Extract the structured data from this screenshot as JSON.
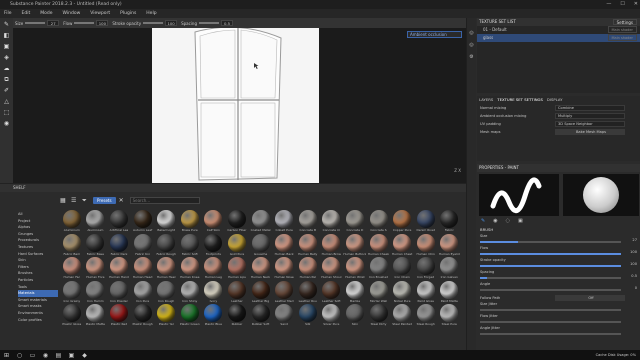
{
  "titlebar": {
    "title": "Substance Painter 2018.2.3 - Untitled (Read only)",
    "min": "—",
    "max": "☐",
    "close": "✕"
  },
  "menu": [
    "File",
    "Edit",
    "Mode",
    "Window",
    "Viewport",
    "Plugins",
    "Help"
  ],
  "toolbar": {
    "size_label": "Size",
    "size_value": "27",
    "flow_label": "Flow",
    "flow_value": "100",
    "stroke_label": "Stroke opacity",
    "stroke_value": "100",
    "spacing_label": "Spacing",
    "spacing_value": "0.5"
  },
  "viewport": {
    "dropdown": "Ambient occlusion",
    "axis": "Z X"
  },
  "shelf": {
    "title": "SHELF",
    "chip": "Presets",
    "search_placeholder": "Search...",
    "categories": [
      "All",
      "Project",
      "Alphas",
      "Grunges",
      "Procedurals",
      "Textures",
      "Hard Surfaces",
      "Skin",
      "Filters",
      "Brushes",
      "Particles",
      "Tools",
      "Materials",
      "Smart materials",
      "Smart masks",
      "Environments",
      "Color profiles"
    ],
    "selected_category": "Materials",
    "materials": [
      {
        "name": "Aluminium",
        "color": "#8a6a3a"
      },
      {
        "name": "Aluminium",
        "color": "#b8b8b8"
      },
      {
        "name": "Artificial Lea",
        "color": "#3a3a3a"
      },
      {
        "name": "Autumn Leaf",
        "color": "#3a2a1a"
      },
      {
        "name": "Baked Light",
        "color": "#e8e8e8"
      },
      {
        "name": "Brass Pure",
        "color": "#c9a24a"
      },
      {
        "name": "Calf Skin",
        "color": "#d8977a"
      },
      {
        "name": "Carbon Fiber",
        "color": "#222222"
      },
      {
        "name": "Coated Metal",
        "color": "#9a9a9a"
      },
      {
        "name": "Cobalt Pure",
        "color": "#c0c0c8"
      },
      {
        "name": "Concrete B",
        "color": "#b0aca6"
      },
      {
        "name": "Concrete Cl",
        "color": "#c8c4be"
      },
      {
        "name": "Concrete D",
        "color": "#a8a49c"
      },
      {
        "name": "Concrete S",
        "color": "#9e9a92"
      },
      {
        "name": "Copper Pure",
        "color": "#c07a4a"
      },
      {
        "name": "Denim Rivet",
        "color": "#3a4a6a"
      },
      {
        "name": "Fabric",
        "color": "#2a2a2a"
      },
      {
        "name": "Fabric Bam",
        "color": "#b09870"
      },
      {
        "name": "Fabric Base",
        "color": "#3a3a3a"
      },
      {
        "name": "Fabric Deni",
        "color": "#2a3a5a"
      },
      {
        "name": "Fabric Kni",
        "color": "#7a7a7a"
      },
      {
        "name": "Fabric Rough",
        "color": "#4a4a4a"
      },
      {
        "name": "Fabric Soft",
        "color": "#5a5a5a"
      },
      {
        "name": "Footprints",
        "color": "#222222"
      },
      {
        "name": "Gold Pure",
        "color": "#d4af37"
      },
      {
        "name": "Gouache",
        "color": "#6a6a6a"
      },
      {
        "name": "Human Back",
        "color": "#e0a08a"
      },
      {
        "name": "Human Belly",
        "color": "#d89a84"
      },
      {
        "name": "Human Brow",
        "color": "#d49680"
      },
      {
        "name": "Human Buttock",
        "color": "#dca28c"
      },
      {
        "name": "Human Cheek",
        "color": "#d89a84"
      },
      {
        "name": "Human Chest",
        "color": "#e0a28c"
      },
      {
        "name": "Human Chin",
        "color": "#d8987e"
      },
      {
        "name": "Human Eyelid",
        "color": "#dca08a"
      },
      {
        "name": "Human Fac",
        "color": "#d89884"
      },
      {
        "name": "Human Fore",
        "color": "#dca08a"
      },
      {
        "name": "Human Hand",
        "color": "#e0a28c"
      },
      {
        "name": "Human Head",
        "color": "#d89a84"
      },
      {
        "name": "Human Heel",
        "color": "#dca08a"
      },
      {
        "name": "Human Knee",
        "color": "#e0a28c"
      },
      {
        "name": "Human Leg",
        "color": "#d89a84"
      },
      {
        "name": "Human Lips",
        "color": "#c07a6a"
      },
      {
        "name": "Human Neck",
        "color": "#dca08a"
      },
      {
        "name": "Human Nose",
        "color": "#e0a28c"
      },
      {
        "name": "Human Pal",
        "color": "#d89a84"
      },
      {
        "name": "Human Shoul",
        "color": "#dca08a"
      },
      {
        "name": "Human Wrist",
        "color": "#e0a28c"
      },
      {
        "name": "Iron Brushed",
        "color": "#8a8a8a"
      },
      {
        "name": "Iron Chain",
        "color": "#5a5a5a"
      },
      {
        "name": "Iron Forged",
        "color": "#4a4a4a"
      },
      {
        "name": "Iron Galvan",
        "color": "#9a9a9a"
      },
      {
        "name": "Iron Grainy",
        "color": "#7a7a7a"
      },
      {
        "name": "Iron Hamm",
        "color": "#8a8a8a"
      },
      {
        "name": "Iron Powder",
        "color": "#6a6a6a"
      },
      {
        "name": "Iron Pure",
        "color": "#b0b0b0"
      },
      {
        "name": "Iron Rough",
        "color": "#7a7a7a"
      },
      {
        "name": "Iron Shiny",
        "color": "#c0c0c0"
      },
      {
        "name": "Ivory",
        "color": "#e8e2d0"
      },
      {
        "name": "Leather",
        "color": "#5a3a2a"
      },
      {
        "name": "Leather Big",
        "color": "#4a2a1a"
      },
      {
        "name": "Leather Med",
        "color": "#6a4a3a"
      },
      {
        "name": "Leather Rou",
        "color": "#3a2a22"
      },
      {
        "name": "Leather Soft",
        "color": "#5a3a2a"
      },
      {
        "name": "Marble",
        "color": "#e8e8e8"
      },
      {
        "name": "Mortar Wall",
        "color": "#a8a8a0"
      },
      {
        "name": "Nickel Pure",
        "color": "#c8c8c0"
      },
      {
        "name": "Paint Gloss",
        "color": "#d8d8d8"
      },
      {
        "name": "Paint Matte",
        "color": "#e0e0e0"
      },
      {
        "name": "Plastic Gloss",
        "color": "#3a3a3a"
      },
      {
        "name": "Plastic Matte",
        "color": "#c8c8c8"
      },
      {
        "name": "Plastic Red",
        "color": "#a01818"
      },
      {
        "name": "Plastic Rough",
        "color": "#2a2a2a"
      },
      {
        "name": "Plastic Yel",
        "color": "#e0c018"
      },
      {
        "name": "Plastic Green",
        "color": "#1a7a2a"
      },
      {
        "name": "Plastic Blue",
        "color": "#1e6ad0"
      },
      {
        "name": "Rubber",
        "color": "#1a1a1a"
      },
      {
        "name": "Rubber Soft",
        "color": "#2a2a2a"
      },
      {
        "name": "Sand",
        "color": "#8a8a8a"
      },
      {
        "name": "Silk",
        "color": "#2a4a6a"
      },
      {
        "name": "Silver Pure",
        "color": "#d0d0d0"
      },
      {
        "name": "Skin",
        "color": "#6a6a6a"
      },
      {
        "name": "Steel Dirty",
        "color": "#3a3a3a"
      },
      {
        "name": "Steel Painted",
        "color": "#b8b8b8"
      },
      {
        "name": "Steel Rough",
        "color": "#a0a0a0"
      },
      {
        "name": "Steel Pure",
        "color": "#c8c8c8"
      }
    ]
  },
  "texture_set_list": {
    "title": "TEXTURE SET LIST",
    "settings": "Settings",
    "rows": [
      {
        "name": "01 - Default",
        "btn": "Main shader"
      },
      {
        "name": "glass",
        "btn": "Main shader"
      }
    ]
  },
  "texture_set_settings": {
    "tabs": [
      "LAYERS",
      "TEXTURE SET SETTINGS",
      "DISPLAY"
    ],
    "fields": [
      {
        "k": "Normal mixing",
        "v": "Combine"
      },
      {
        "k": "Ambient occlusion mixing",
        "v": "Multiply"
      },
      {
        "k": "UV padding",
        "v": "3D Space Neighbor"
      },
      {
        "k": "Mesh maps",
        "v": "Bake Mesh Maps"
      }
    ]
  },
  "properties": {
    "title": "PROPERTIES - PAINT",
    "brush_section": "BRUSH",
    "props": [
      {
        "label": "Size",
        "value": "27",
        "fill": 0.27
      },
      {
        "label": "Flow",
        "value": "100",
        "fill": 1.0
      },
      {
        "label": "Stroke opacity",
        "value": "100",
        "fill": 1.0
      },
      {
        "label": "Spacing",
        "value": "0.5",
        "fill": 0.05
      },
      {
        "label": "Angle",
        "value": "0",
        "fill": 0.0
      }
    ],
    "follow_path_label": "Follow Path",
    "follow_path_value": "Off",
    "size_jitter": "Size Jitter",
    "flow_jitter": "Flow Jitter",
    "angle_jitter": "Angle Jitter"
  },
  "taskbar": {
    "tray": "Cache Disk Usage: 0%"
  }
}
